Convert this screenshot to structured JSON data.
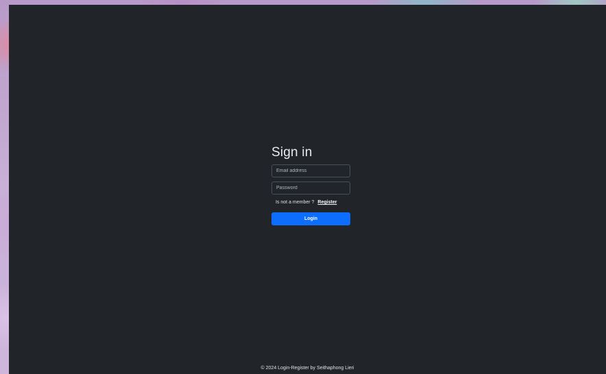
{
  "signin": {
    "title": "Sign in",
    "email_placeholder": "Email address",
    "password_placeholder": "Password",
    "member_prompt": "Is not a member ?",
    "register_label": "Register",
    "login_label": "Login"
  },
  "footer": {
    "text": "© 2024 Login-Register by Seithaphong Lieri"
  },
  "colors": {
    "background": "#212529",
    "primary": "#0d6efd"
  }
}
